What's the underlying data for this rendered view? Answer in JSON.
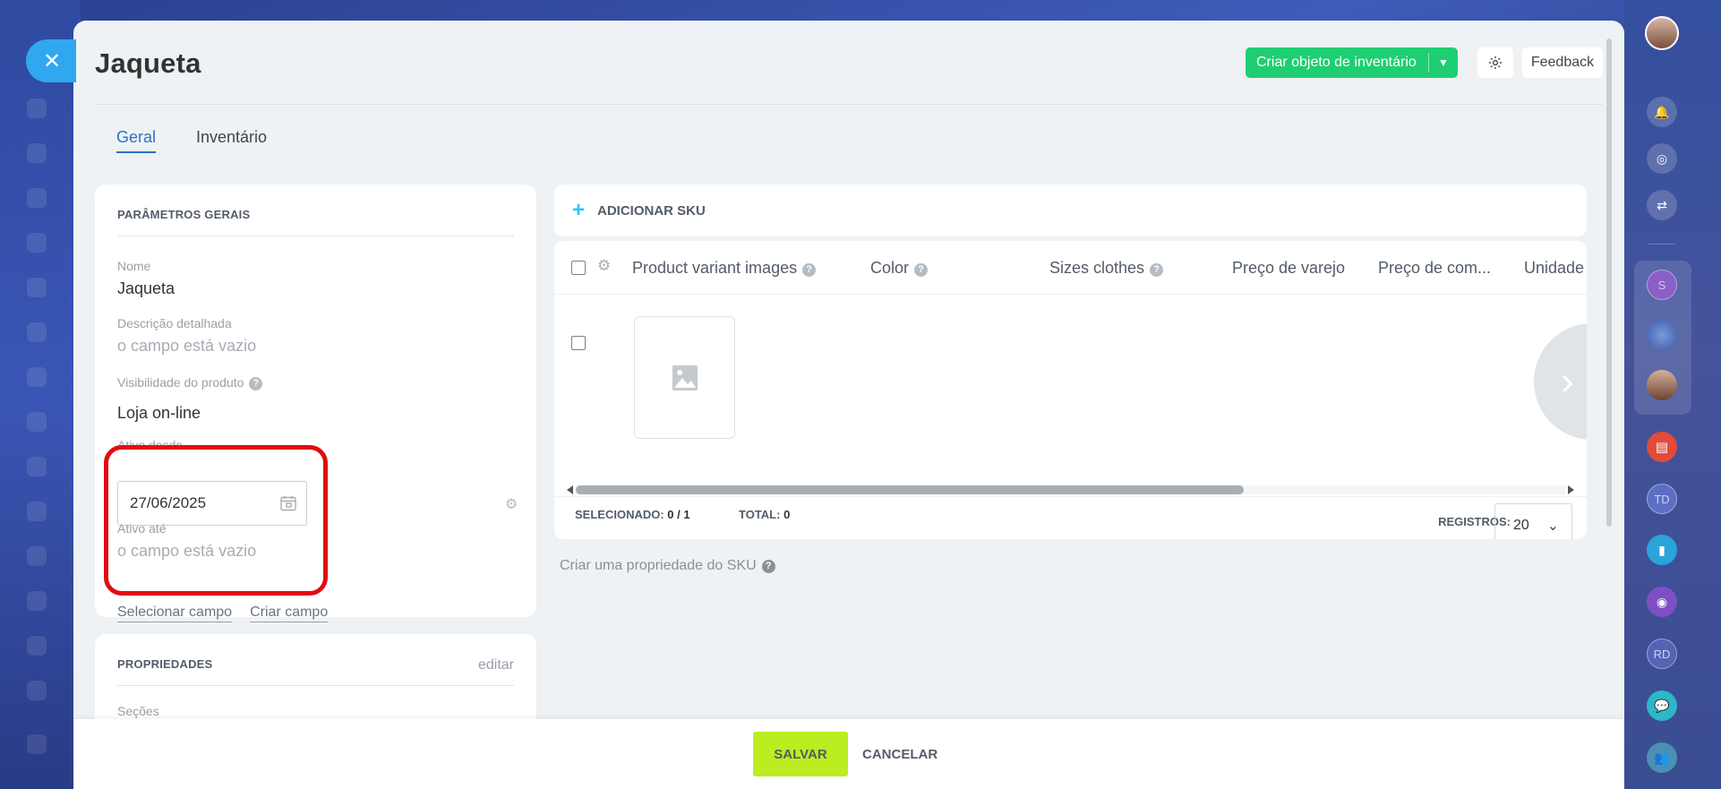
{
  "product": {
    "title": "Jaqueta"
  },
  "header": {
    "create_button": "Criar objeto de inventário",
    "feedback": "Feedback"
  },
  "tabs": [
    {
      "label": "Geral",
      "active": true
    },
    {
      "label": "Inventário",
      "active": false
    }
  ],
  "general_params": {
    "section_title": "PARÂMETROS GERAIS",
    "name_label": "Nome",
    "name_value": "Jaqueta",
    "description_label": "Descrição detalhada",
    "description_value": "o campo está vazio",
    "visibility_label": "Visibilidade do produto",
    "visibility_value": "Loja on-line",
    "active_from_label": "Ativo desde",
    "active_from_value": "27/06/2025",
    "active_to_label": "Ativo até",
    "active_to_value": "o campo está vazio",
    "select_field_link": "Selecionar campo",
    "create_field_link": "Criar campo"
  },
  "properties": {
    "section_title": "PROPRIEDADES",
    "edit_link": "editar",
    "sections_label": "Seções"
  },
  "sku": {
    "add_label": "ADICIONAR SKU",
    "columns": [
      {
        "label": "Product variant images",
        "help": true
      },
      {
        "label": "Color",
        "help": true
      },
      {
        "label": "Sizes clothes",
        "help": true
      },
      {
        "label": "Preço de varejo",
        "help": false
      },
      {
        "label": "Preço de com...",
        "help": false
      },
      {
        "label": "Unidade d",
        "help": false
      }
    ],
    "selected_label": "SELECIONADO:",
    "selected_value": "0 / 1",
    "total_label": "TOTAL:",
    "total_value": "0",
    "records_label": "REGISTROS:",
    "records_value": "20",
    "create_property_link": "Criar uma propriedade do SKU"
  },
  "footer": {
    "save": "SALVAR",
    "cancel": "CANCELAR"
  },
  "rail": {
    "initials_s": "S",
    "initials_td": "TD",
    "initials_rd": "RD"
  },
  "colors": {
    "accent_green": "#1fce72",
    "save_lime": "#bbed21",
    "highlight_red": "#e10d12",
    "tab_active": "#2b72c9",
    "close_blue": "#2fa8f0"
  }
}
